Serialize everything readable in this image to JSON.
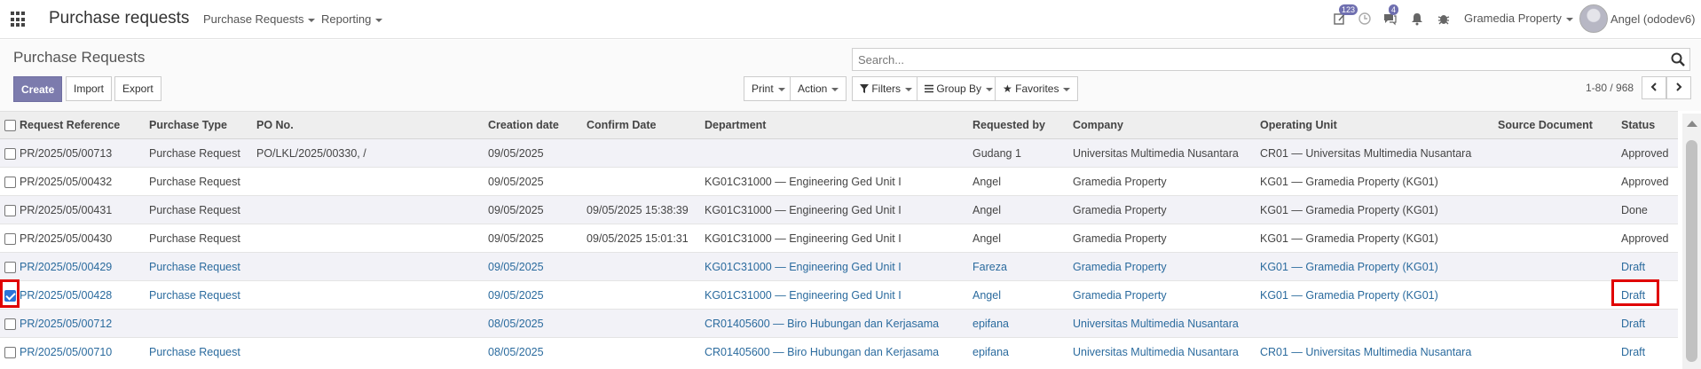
{
  "navbar": {
    "app_title": "Purchase requests",
    "menus": [
      "Purchase Requests",
      "Reporting"
    ],
    "activity_badge": "123",
    "messages_badge": "4",
    "company": "Gramedia Property",
    "user": "Angel (ododev6)"
  },
  "control_panel": {
    "title": "Purchase Requests",
    "search_placeholder": "Search...",
    "create_label": "Create",
    "import_label": "Import",
    "export_label": "Export",
    "print_label": "Print",
    "action_label": "Action",
    "filters_label": "Filters",
    "groupby_label": "Group By",
    "favorites_label": "Favorites",
    "pager": "1-80 / 968"
  },
  "table": {
    "columns": [
      "Request Reference",
      "Purchase Type",
      "PO No.",
      "Creation date",
      "Confirm Date",
      "Department",
      "Requested by",
      "Company",
      "Operating Unit",
      "Source Document",
      "Status"
    ],
    "rows": [
      {
        "ref": "PR/2025/05/00713",
        "type": "Purchase Request",
        "po": "PO/LKL/2025/00330, /",
        "created": "09/05/2025",
        "confirmed": "",
        "department": "",
        "requested_by": "Gudang 1",
        "company": "Universitas Multimedia Nusantara",
        "unit": "CR01 — Universitas Multimedia Nusantara",
        "source": "",
        "status": "Approved",
        "draft": false,
        "checked": false
      },
      {
        "ref": "PR/2025/05/00432",
        "type": "Purchase Request",
        "po": "",
        "created": "09/05/2025",
        "confirmed": "",
        "department": "KG01C31000 — Engineering Ged Unit I",
        "requested_by": "Angel",
        "company": "Gramedia Property",
        "unit": "KG01 — Gramedia Property (KG01)",
        "source": "",
        "status": "Approved",
        "draft": false,
        "checked": false
      },
      {
        "ref": "PR/2025/05/00431",
        "type": "Purchase Request",
        "po": "",
        "created": "09/05/2025",
        "confirmed": "09/05/2025 15:38:39",
        "department": "KG01C31000 — Engineering Ged Unit I",
        "requested_by": "Angel",
        "company": "Gramedia Property",
        "unit": "KG01 — Gramedia Property (KG01)",
        "source": "",
        "status": "Done",
        "draft": false,
        "checked": false
      },
      {
        "ref": "PR/2025/05/00430",
        "type": "Purchase Request",
        "po": "",
        "created": "09/05/2025",
        "confirmed": "09/05/2025 15:01:31",
        "department": "KG01C31000 — Engineering Ged Unit I",
        "requested_by": "Angel",
        "company": "Gramedia Property",
        "unit": "KG01 — Gramedia Property (KG01)",
        "source": "",
        "status": "Approved",
        "draft": false,
        "checked": false
      },
      {
        "ref": "PR/2025/05/00429",
        "type": "Purchase Request",
        "po": "",
        "created": "09/05/2025",
        "confirmed": "",
        "department": "KG01C31000 — Engineering Ged Unit I",
        "requested_by": "Fareza",
        "company": "Gramedia Property",
        "unit": "KG01 — Gramedia Property (KG01)",
        "source": "",
        "status": "Draft",
        "draft": true,
        "checked": false
      },
      {
        "ref": "PR/2025/05/00428",
        "type": "Purchase Request",
        "po": "",
        "created": "09/05/2025",
        "confirmed": "",
        "department": "KG01C31000 — Engineering Ged Unit I",
        "requested_by": "Angel",
        "company": "Gramedia Property",
        "unit": "KG01 — Gramedia Property (KG01)",
        "source": "",
        "status": "Draft",
        "draft": true,
        "checked": true
      },
      {
        "ref": "PR/2025/05/00712",
        "type": "",
        "po": "",
        "created": "08/05/2025",
        "confirmed": "",
        "department": "CR01405600 — Biro Hubungan dan Kerjasama",
        "requested_by": "epifana",
        "company": "Universitas Multimedia Nusantara",
        "unit": "",
        "source": "",
        "status": "Draft",
        "draft": true,
        "checked": false
      },
      {
        "ref": "PR/2025/05/00710",
        "type": "Purchase Request",
        "po": "",
        "created": "08/05/2025",
        "confirmed": "",
        "department": "CR01405600 — Biro Hubungan dan Kerjasama",
        "requested_by": "epifana",
        "company": "Universitas Multimedia Nusantara",
        "unit": "CR01 — Universitas Multimedia Nusantara",
        "source": "",
        "status": "Draft",
        "draft": true,
        "checked": false
      }
    ]
  },
  "colors": {
    "primary": "#7c7bad",
    "draft_text": "#2b6b9e",
    "highlight": "#e00000",
    "checkbox_checked": "#2b74d8"
  }
}
